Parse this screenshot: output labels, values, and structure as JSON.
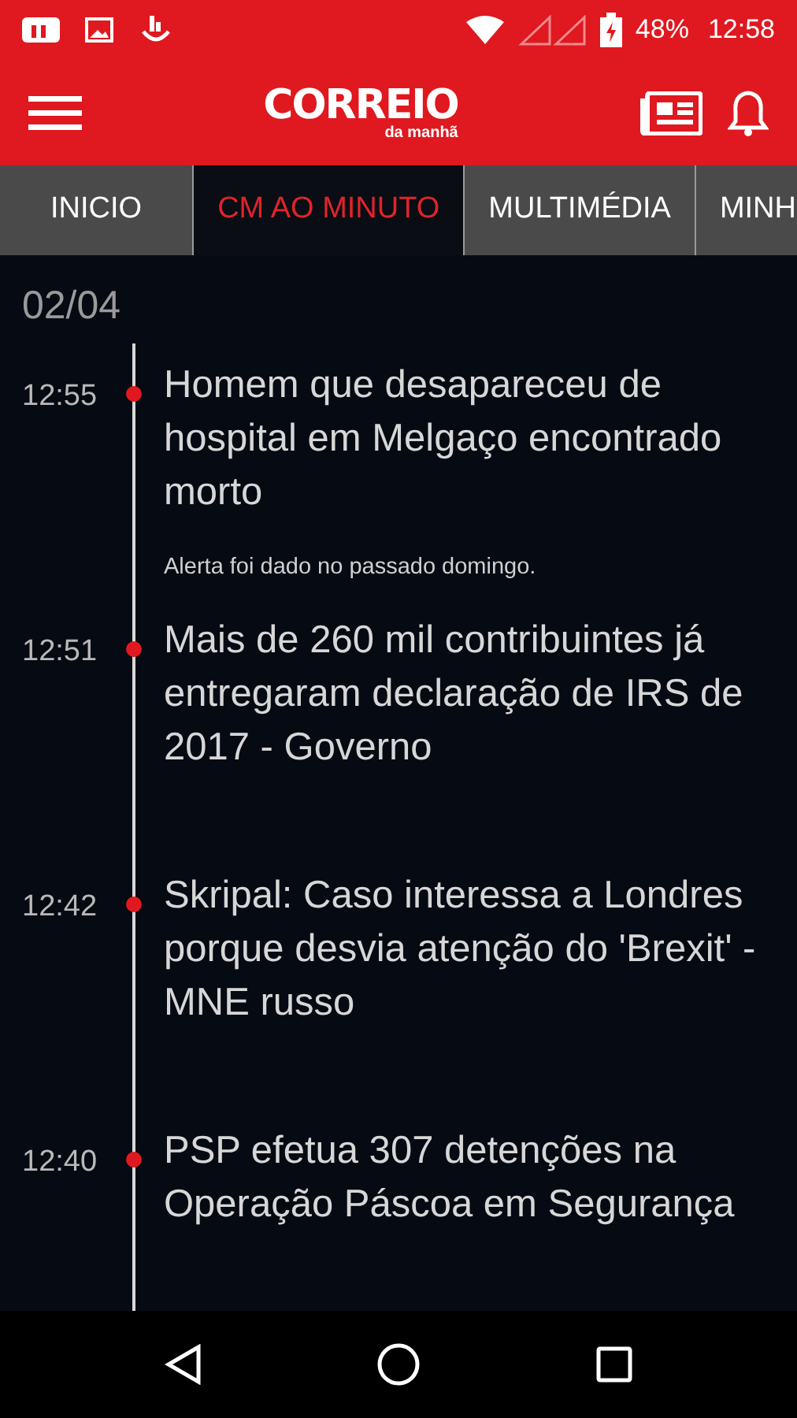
{
  "status_bar": {
    "battery": "48%",
    "time": "12:58"
  },
  "header": {
    "logo": "CORREIO",
    "logo_sub": "da manhã"
  },
  "tabs": [
    {
      "label": "INICIO",
      "selected": false
    },
    {
      "label": "CM AO MINUTO",
      "selected": true
    },
    {
      "label": "MULTIMÉDIA",
      "selected": false
    },
    {
      "label": "MINH",
      "selected": false
    }
  ],
  "date": "02/04",
  "news": [
    {
      "time": "12:55",
      "headline": "Homem que desapareceu de hospital em Melgaço encontrado morto",
      "summary": "Alerta foi dado no passado domingo."
    },
    {
      "time": "12:51",
      "headline": "Mais de 260 mil contribuintes já entregaram declaração de IRS de 2017 - Governo"
    },
    {
      "time": "12:42",
      "headline": "Skripal: Caso interessa a Londres porque desvia atenção do 'Brexit' - MNE russo"
    },
    {
      "time": "12:40",
      "headline": "PSP efetua 307 detenções na Operação Páscoa em Segurança"
    }
  ]
}
